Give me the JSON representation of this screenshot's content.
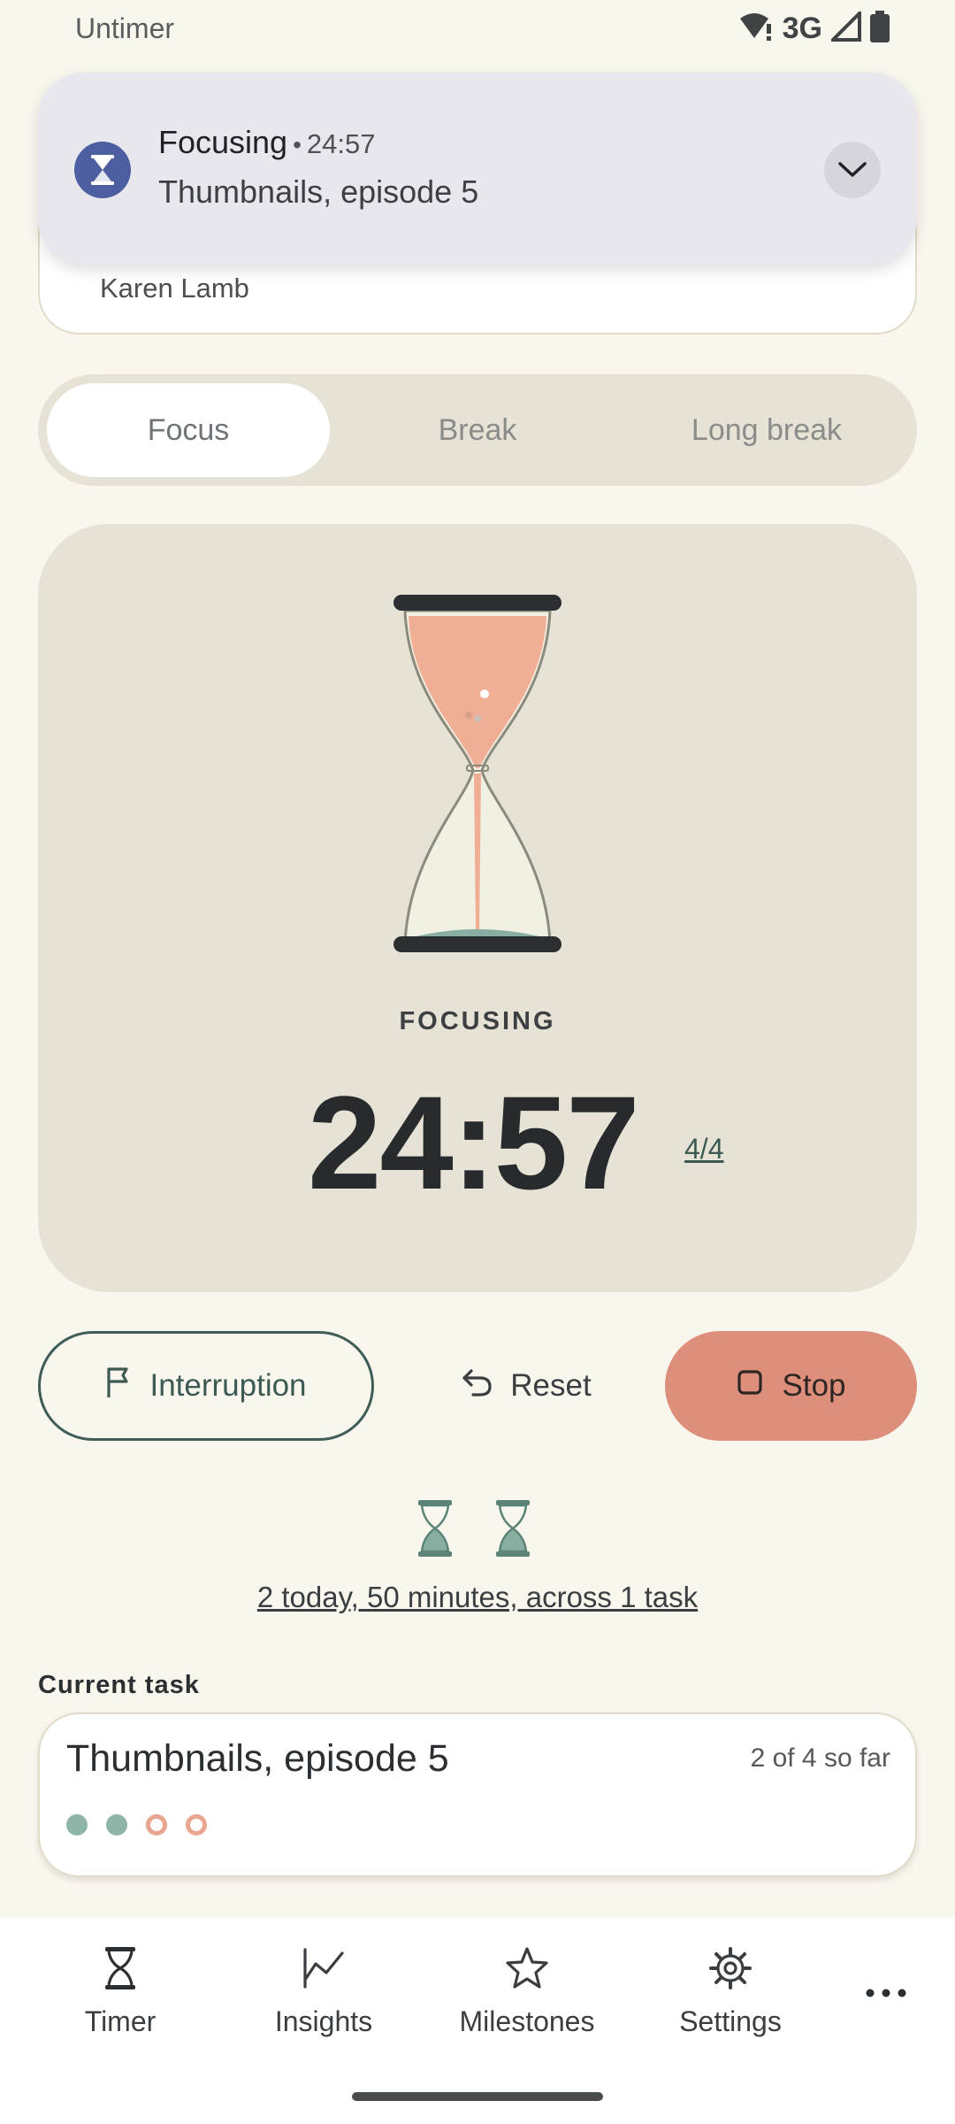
{
  "status_bar": {
    "app_name": "Untimer",
    "network": "3G",
    "icons": [
      "wifi-alert-icon",
      "signal-icon",
      "battery-icon"
    ]
  },
  "notification": {
    "title": "Focusing",
    "time": "24:57",
    "body": "Thumbnails, episode 5",
    "icon": "hourglass-icon",
    "expand_icon": "chevron-down-icon"
  },
  "profile": {
    "name": "Karen Lamb"
  },
  "modes": {
    "tabs": [
      {
        "label": "Focus",
        "active": true
      },
      {
        "label": "Break",
        "active": false
      },
      {
        "label": "Long break",
        "active": false
      }
    ]
  },
  "timer": {
    "state_label": "FOCUSING",
    "time": "24:57",
    "round": "4/4",
    "colors": {
      "sand": "#f0ae95",
      "base": "#88aea2",
      "frame": "#2c2f31"
    }
  },
  "actions": {
    "interruption_label": "Interruption",
    "reset_label": "Reset",
    "stop_label": "Stop"
  },
  "today": {
    "completed_count": 2,
    "summary": "2 today, 50 minutes, across 1 task"
  },
  "current_task": {
    "heading": "Current task",
    "title": "Thumbnails, episode 5",
    "progress": "2 of 4 so far",
    "sessions_done": 2,
    "sessions_total": 4
  },
  "nav": {
    "items": [
      {
        "label": "Timer",
        "icon": "hourglass-icon"
      },
      {
        "label": "Insights",
        "icon": "trend-line-icon"
      },
      {
        "label": "Milestones",
        "icon": "star-icon"
      },
      {
        "label": "Settings",
        "icon": "gear-icon"
      }
    ],
    "more_icon": "more-horizontal-icon"
  },
  "theme": {
    "background": "#f9f6ee",
    "panel": "#e6e2d6",
    "accent_green": "#3d5d56",
    "stop_color": "#dd8f7b",
    "notification_icon_bg": "#4d5ea1"
  }
}
